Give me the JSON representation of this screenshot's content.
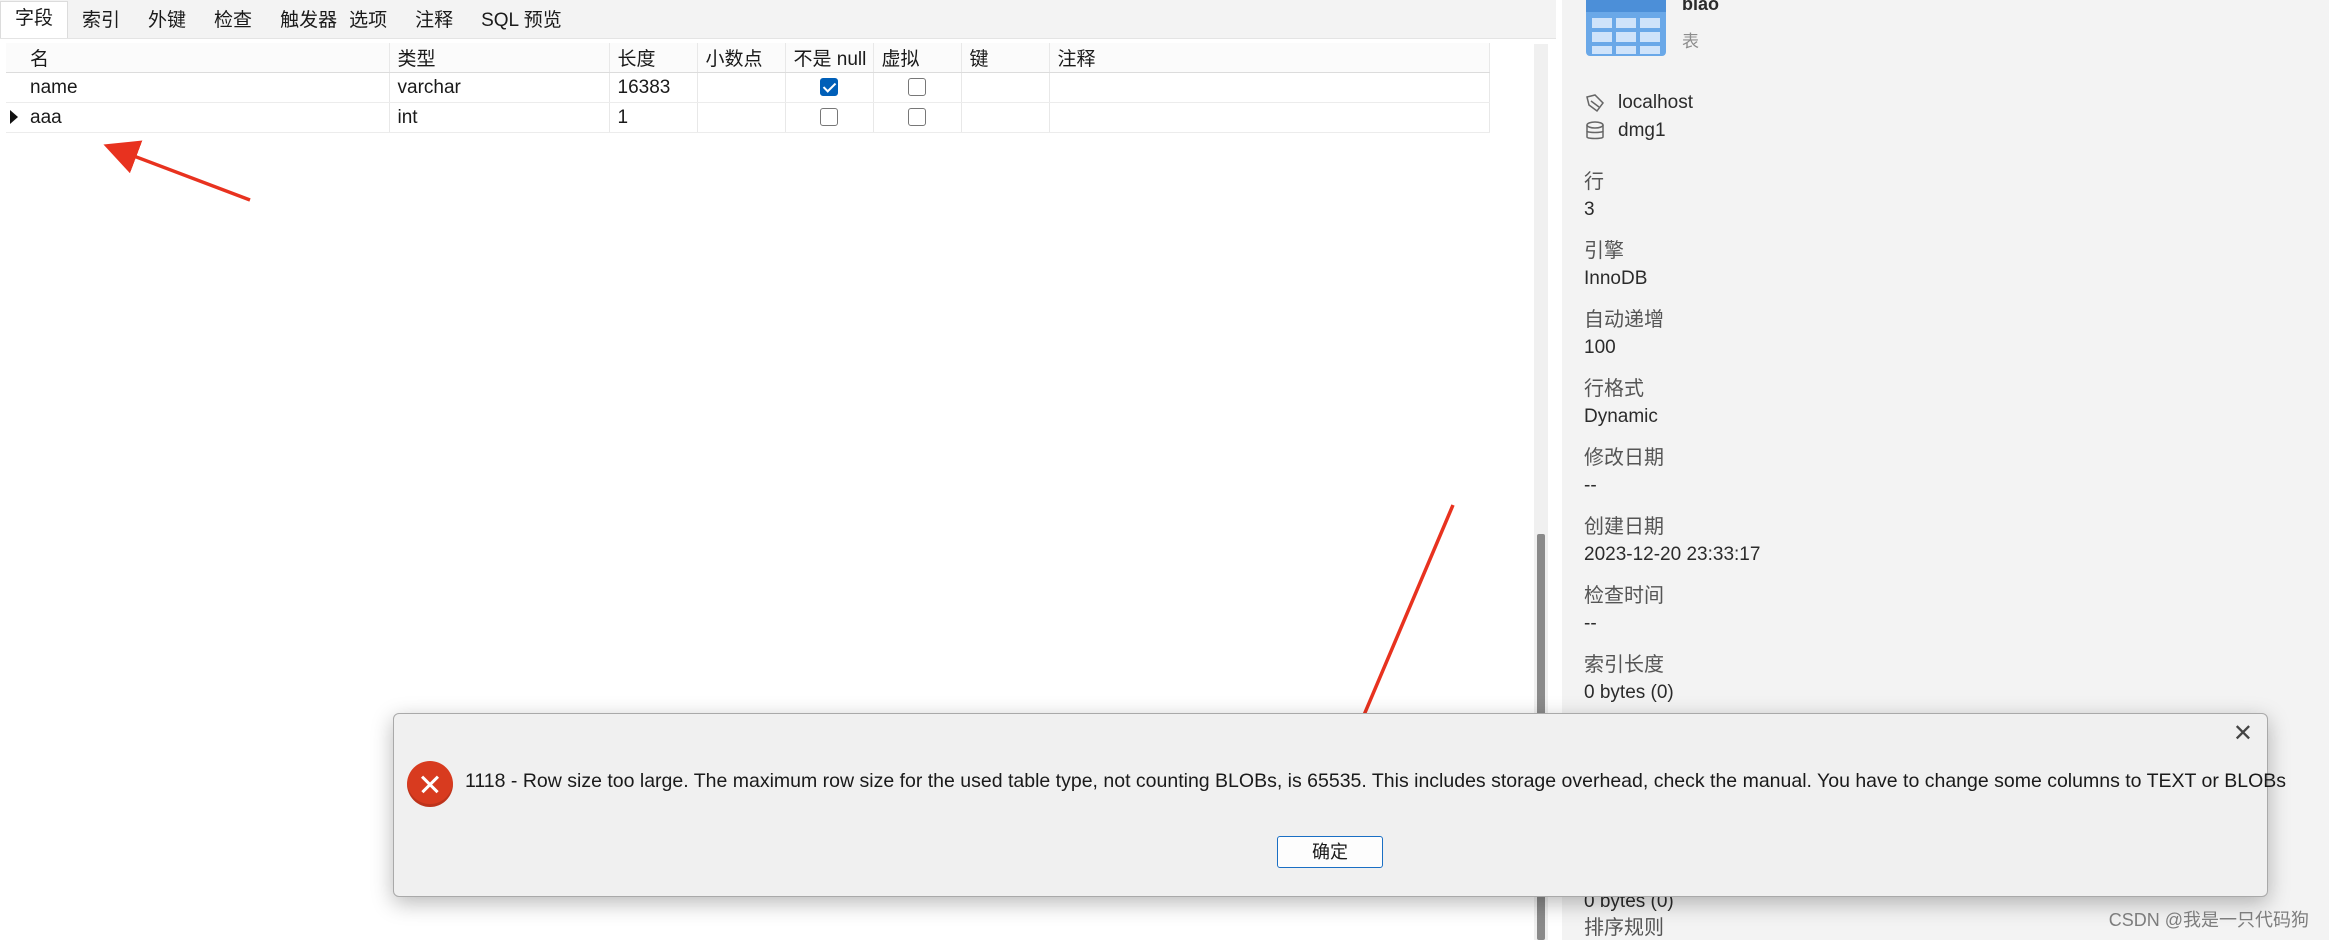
{
  "tabs": [
    {
      "label": "字段"
    },
    {
      "label": "索引"
    },
    {
      "label": "外键"
    },
    {
      "label": "检查"
    },
    {
      "label": "触发器"
    },
    {
      "label": "选项"
    },
    {
      "label": "注释"
    },
    {
      "label": "SQL 预览"
    }
  ],
  "grid": {
    "headers": [
      "名",
      "类型",
      "长度",
      "小数点",
      "不是 null",
      "虚拟",
      "键",
      "注释"
    ],
    "rows": [
      {
        "name": "name",
        "type": "varchar",
        "length": "16383",
        "decimal": "",
        "not_null": true,
        "virtual": false,
        "key": "",
        "comment": ""
      },
      {
        "name": "aaa",
        "type": "int",
        "length": "1",
        "decimal": "",
        "not_null": false,
        "virtual": false,
        "key": "",
        "comment": ""
      }
    ]
  },
  "panel": {
    "table_name": "biao",
    "table_type": "表",
    "connection": "localhost",
    "database": "dmg1",
    "props": [
      {
        "key": "行",
        "value": "3"
      },
      {
        "key": "引擎",
        "value": "InnoDB"
      },
      {
        "key": "自动递增",
        "value": "100"
      },
      {
        "key": "行格式",
        "value": "Dynamic"
      },
      {
        "key": "修改日期",
        "value": "--"
      },
      {
        "key": "创建日期",
        "value": "2023-12-20 23:33:17"
      },
      {
        "key": "检查时间",
        "value": "--"
      },
      {
        "key": "索引长度",
        "value": "0 bytes (0)"
      }
    ],
    "partial_value": "0 bytes (0)",
    "partial_key": "排序规则"
  },
  "dialog": {
    "message": "1118 - Row size too large. The maximum row size for the used table type, not counting BLOBs, is 65535. This includes storage overhead, check the manual. You have to change some columns to TEXT or BLOBs",
    "ok_label": "确定",
    "close_glyph": "✕"
  },
  "watermark": "CSDN @我是一只代码狗",
  "colors": {
    "accent": "#005fb8",
    "error": "#d83b1f",
    "annotation": "#e8321f"
  },
  "icons": [
    "table-icon",
    "connection-icon",
    "database-icon",
    "error-icon",
    "close-icon",
    "row-pointer-icon"
  ]
}
